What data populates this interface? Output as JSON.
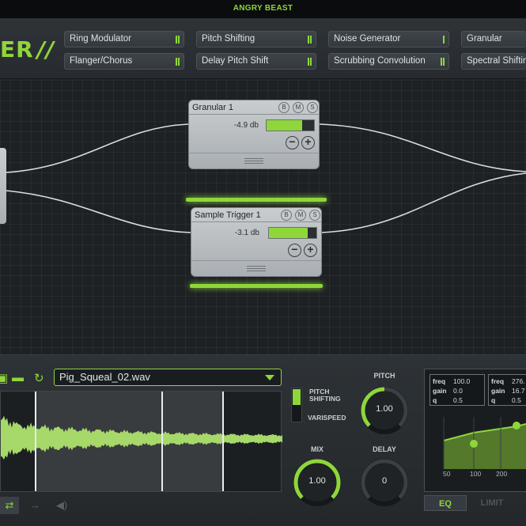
{
  "title_bar": {
    "brand": "ANGRY BEAST"
  },
  "header": {
    "logo_text": "ER",
    "logo_tail": "//",
    "effects": [
      {
        "label": "Ring Modulator"
      },
      {
        "label": "Pitch Shifting"
      },
      {
        "label": "Noise Generator"
      },
      {
        "label": "Granular"
      },
      {
        "label": "Flanger/Chorus"
      },
      {
        "label": "Delay Pitch Shift"
      },
      {
        "label": "Scrubbing Convolution"
      },
      {
        "label": "Spectral Shifting"
      }
    ]
  },
  "graph": {
    "nodes": [
      {
        "title": "Granular 1",
        "level": "-4.9 db",
        "meter_fraction": 0.75,
        "buttons": [
          "B",
          "M",
          "S"
        ],
        "minus": "−",
        "plus": "+"
      },
      {
        "title": "Sample Trigger 1",
        "level": "-3.1 db",
        "meter_fraction": 0.82,
        "buttons": [
          "B",
          "M",
          "S"
        ],
        "minus": "−",
        "plus": "+"
      }
    ]
  },
  "sample": {
    "file_name": "Pig_Squeal_02.wav",
    "icons": [
      "save-icon",
      "folder-icon",
      "reload-icon"
    ]
  },
  "mode": {
    "option_a": "PITCH\nSHIFTING",
    "option_b": "VARISPEED",
    "selected": "PITCH SHIFTING"
  },
  "knobs": {
    "pitch": {
      "label": "PITCH",
      "value": "1.00",
      "fraction": 0.5
    },
    "mix": {
      "label": "MIX",
      "value": "1.00",
      "fraction": 0.5
    },
    "delay": {
      "label": "DELAY",
      "value": "0",
      "fraction": 0.0
    }
  },
  "eq": {
    "bands": [
      {
        "freq": "100.0",
        "gain": "0.0",
        "q": "0.5"
      },
      {
        "freq": "276.",
        "gain": "16.7",
        "q": "0.5"
      }
    ],
    "labels": {
      "freq": "freq",
      "gain": "gain",
      "q": "q"
    },
    "axis": [
      "50",
      "100",
      "200"
    ],
    "tabs": {
      "eq": "EQ",
      "limit": "LIMIT",
      "active": "EQ"
    }
  },
  "colors": {
    "accent": "#8fd63a",
    "panel": "#2d3236",
    "node": "#c0c4c7"
  }
}
